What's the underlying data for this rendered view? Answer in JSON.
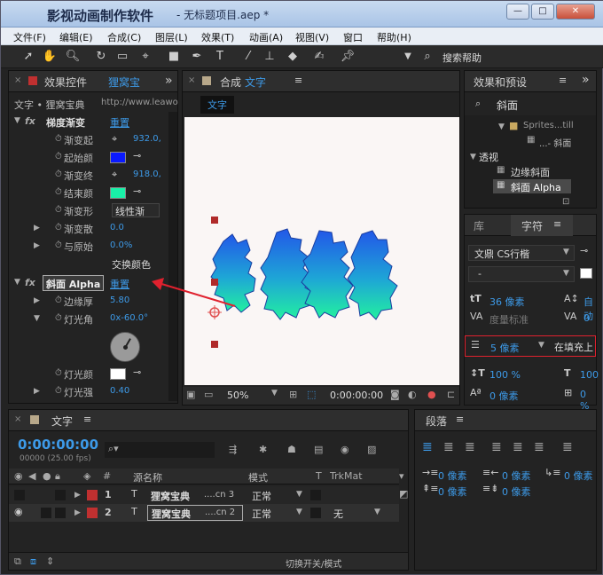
{
  "window": {
    "app_title": "影视动画制作软件",
    "doc_title": "- 无标题项目.aep *",
    "buttons": [
      "—",
      "□",
      "✕"
    ]
  },
  "menubar": [
    "文件(F)",
    "编辑(E)",
    "合成(C)",
    "图层(L)",
    "效果(T)",
    "动画(A)",
    "视图(V)",
    "窗口",
    "帮助(H)"
  ],
  "toolbar": {
    "search_label": "搜索帮助"
  },
  "effects_panel": {
    "tab_label": "效果控件",
    "tab_layer": "狸窝宝",
    "breadcrumb": "文字 • 狸窝宝典",
    "url": "http://www.leawo",
    "fx1": {
      "name": "梯度渐变",
      "reset": "重置",
      "props": [
        {
          "label": "渐变起",
          "value": "932.0,"
        },
        {
          "label": "起始颜",
          "color": "#0a1aff"
        },
        {
          "label": "渐变终",
          "value": "918.0,"
        },
        {
          "label": "结束颜",
          "color": "#19f0a8"
        },
        {
          "label": "渐变形",
          "value": "线性渐"
        },
        {
          "label": "渐变散",
          "value": "0.0"
        },
        {
          "label": "与原始",
          "value": "0.0%"
        }
      ],
      "swap_label": "交换颜色"
    },
    "fx2": {
      "name": "斜面 Alpha",
      "reset": "重置",
      "props": [
        {
          "label": "边缘厚",
          "value": "5.80"
        },
        {
          "label": "灯光角",
          "value": "0x-60.0°"
        },
        {
          "label": "灯光颜",
          "color": "#ffffff"
        },
        {
          "label": "灯光强",
          "value": "0.40"
        }
      ]
    }
  },
  "comp_panel": {
    "tab_prefix": "合成",
    "tab_name": "文字",
    "chip": "文字",
    "zoom": "50%",
    "timecode": "0:00:00:00"
  },
  "effects_presets": {
    "tab": "效果和预设",
    "search": "斜面",
    "tree": [
      {
        "label": "Sprites...till",
        "level": 2
      },
      {
        "label": "...- 斜面",
        "level": 3
      },
      {
        "label": "透视",
        "level": 0
      },
      {
        "label": "边缘斜面",
        "level": 1
      },
      {
        "label": "斜面 Alpha",
        "level": 1
      }
    ]
  },
  "character_panel": {
    "tab_lib": "库",
    "tab_char": "字符",
    "font": "文鼎 CS行楷",
    "style": "-",
    "size": "36 像素",
    "leading": "自动",
    "kerning": "度量标准",
    "tracking": "0",
    "stroke": "5 像素",
    "stroke_mode": "在填充上",
    "vscale": "100 %",
    "hscale": "100",
    "baseline": "0 像素",
    "tsume": "0 %"
  },
  "timeline": {
    "tab": "文字",
    "timecode": "0:00:00:00",
    "frames": "00000 (25.00 fps)",
    "columns": {
      "num": "#",
      "source": "源名称",
      "mode": "模式",
      "t": "T",
      "trkmat": "TrkMat"
    },
    "layers": [
      {
        "num": "1",
        "name": "狸窝宝典",
        "suffix": "....cn 3",
        "mode": "正常",
        "trkmat": ""
      },
      {
        "num": "2",
        "name": "狸窝宝典",
        "suffix": "....cn 2",
        "mode": "正常",
        "trkmat": "无"
      }
    ],
    "footer": "切换开关/模式"
  },
  "paragraph_panel": {
    "tab": "段落",
    "indent_left": "0 像素",
    "indent_right": "0 像素",
    "indent_first": "0 像素",
    "space_before": "0 像素",
    "space_after": "0 像素"
  },
  "colors": {
    "accent": "#3d9ae8",
    "highlight": "#e0212e"
  }
}
